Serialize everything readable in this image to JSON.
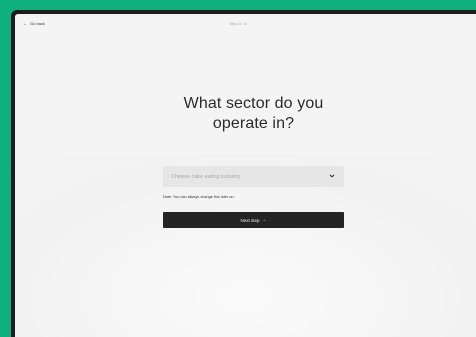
{
  "header": {
    "back_label": "Go back",
    "back_icon": "arrow-left-icon",
    "step_label": "Step 5 / 6"
  },
  "form": {
    "question": "What sector do you operate in?",
    "select": {
      "placeholder": "Cheese cake eating industry",
      "icon": "chevron-down-icon"
    },
    "note": "Note: You can always change this later on.",
    "next_button": {
      "label": "Next step",
      "icon": "arrow-right-icon"
    }
  },
  "colors": {
    "background_accent": "#10b07e",
    "screen_background": "#f4f4f4",
    "button_background": "#242424",
    "select_background": "#e6e6e6"
  }
}
